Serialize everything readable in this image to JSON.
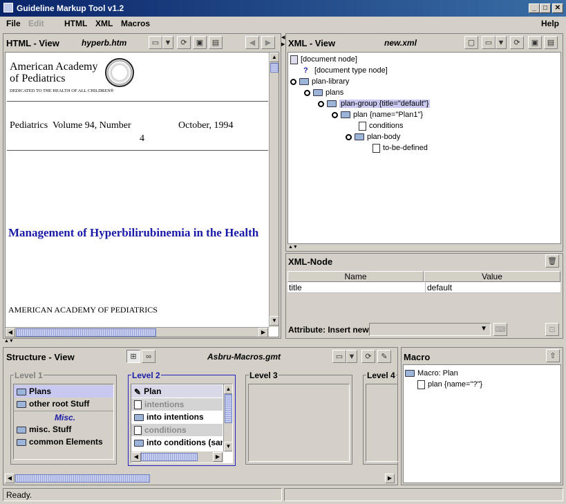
{
  "window": {
    "title": "Guideline Markup Tool v1.2",
    "minimize": "_",
    "maximize": "□",
    "close": "✕"
  },
  "menu": {
    "file": "File",
    "edit": "Edit",
    "html": "HTML",
    "xml": "XML",
    "macros": "Macros",
    "help": "Help"
  },
  "html_view": {
    "title": "HTML - View",
    "file": "hyperb.htm",
    "org_line1": "American Academy",
    "org_line2": "of Pediatrics",
    "org_tagline": "DEDICATED TO THE HEALTH OF ALL CHILDREN®",
    "journal": "Pediatrics  Volume 94, Number",
    "issue": "4",
    "date": "October, 1994",
    "headline": "Management of Hyperbilirubinemia in the Health",
    "footer": "AMERICAN ACADEMY OF PEDIATRICS"
  },
  "xml_view": {
    "title": "XML - View",
    "file": "new.xml",
    "nodes": [
      {
        "label": "[document node]"
      },
      {
        "label": "[document type node]"
      },
      {
        "label": "plan-library"
      },
      {
        "label": "plans"
      },
      {
        "label": "plan-group {title=\"default\"}"
      },
      {
        "label": "plan {name=\"Plan1\"}"
      },
      {
        "label": "conditions"
      },
      {
        "label": "plan-body"
      },
      {
        "label": "to-be-defined"
      }
    ]
  },
  "xml_node": {
    "title": "XML-Node",
    "columns": [
      "Name",
      "Value"
    ],
    "rows": [
      {
        "name": "title",
        "value": "default"
      }
    ],
    "attribute_label": "Attribute: Insert new"
  },
  "structure_view": {
    "title": "Structure - View",
    "file": "Asbru-Macros.gmt",
    "level1": {
      "label": "Level 1",
      "items": [
        "Plans",
        "other root Stuff"
      ],
      "misc": "Misc.",
      "misc_items": [
        "misc. Stuff",
        "common Elements"
      ]
    },
    "level2": {
      "label": "Level 2",
      "items": [
        "Plan",
        "intentions",
        "into intentions",
        "conditions",
        "into conditions (sam"
      ]
    },
    "level3": {
      "label": "Level 3"
    },
    "level4": {
      "label": "Level 4"
    }
  },
  "macro": {
    "title": "Macro",
    "nodes": [
      "Macro: Plan",
      "plan {name=\"?\"}"
    ]
  },
  "status": {
    "text": "Ready."
  }
}
